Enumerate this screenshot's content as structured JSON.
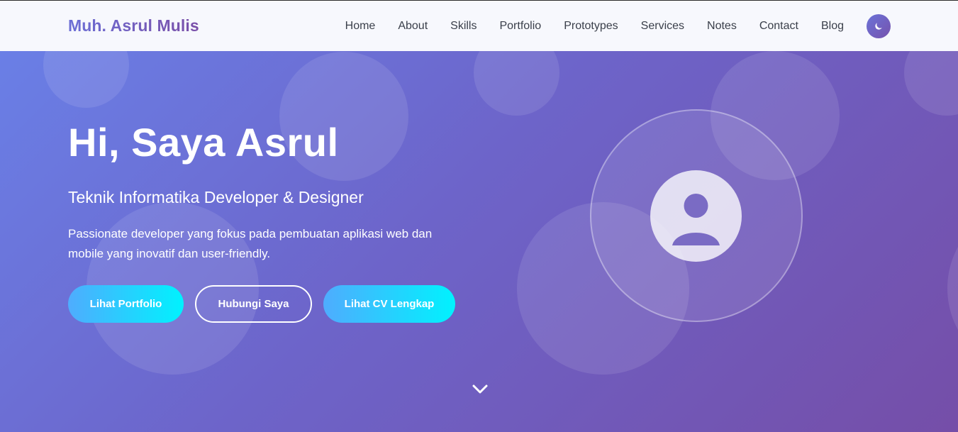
{
  "navbar": {
    "logo": "Muh. Asrul Mulis",
    "links": [
      "Home",
      "About",
      "Skills",
      "Portfolio",
      "Prototypes",
      "Services",
      "Notes",
      "Contact",
      "Blog"
    ],
    "theme_toggle_icon": "moon-icon"
  },
  "hero": {
    "title": "Hi, Saya Asrul",
    "subtitle": "Teknik Informatika Developer & Designer",
    "description": "Passionate developer yang fokus pada pembuatan aplikasi web dan mobile yang inovatif dan user-friendly.",
    "buttons": {
      "portfolio": "Lihat Portfolio",
      "contact": "Hubungi Saya",
      "cv": "Lihat CV Lengkap"
    },
    "avatar_icon": "user-icon",
    "scroll_icon": "chevron-down-icon"
  },
  "colors": {
    "brand_gradient_start": "#6a7fe6",
    "brand_gradient_end": "#754ea8",
    "button_gradient_start": "#4facfe",
    "button_gradient_end": "#00f2fe",
    "nav_background": "#f7f8fd",
    "nav_text": "#3a3f4a"
  }
}
